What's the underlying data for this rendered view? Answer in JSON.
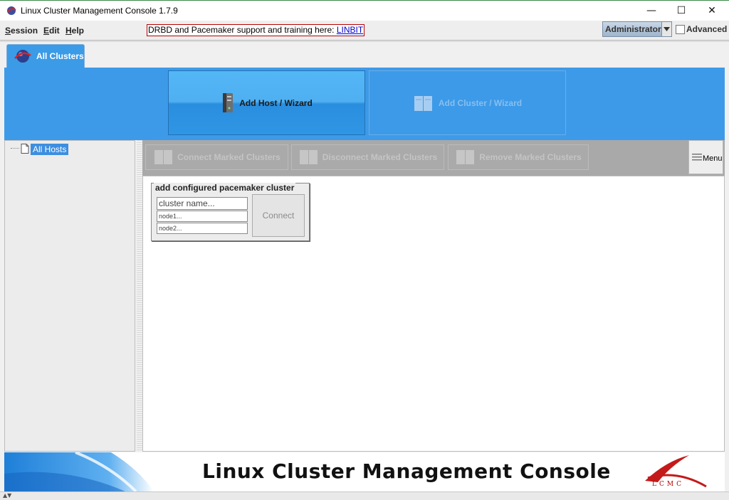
{
  "window": {
    "title": "Linux Cluster Management Console 1.7.9",
    "minimize_glyph": "—",
    "maximize_glyph": "☐",
    "close_glyph": "✕"
  },
  "menubar": {
    "items": [
      {
        "label": "Session"
      },
      {
        "label": "Edit"
      },
      {
        "label": "Help"
      }
    ],
    "promo_text": "DRBD and Pacemaker support and training here: ",
    "promo_link": "LINBIT",
    "user_mode": "Administrator",
    "advanced_label": "Advanced",
    "advanced_checked": false
  },
  "tabs": [
    {
      "label": "All Clusters",
      "icon": "all-clusters-icon",
      "selected": true
    }
  ],
  "wizards": {
    "add_host": {
      "label": "Add Host / Wizard",
      "enabled": true,
      "icon": "server-icon"
    },
    "add_cluster": {
      "label": "Add Cluster / Wizard",
      "enabled": false,
      "icon": "servers-icon"
    }
  },
  "tree": {
    "root_label": "All Hosts"
  },
  "cluster_toolbar": {
    "buttons": [
      {
        "label": "Connect Marked Clusters",
        "enabled": false
      },
      {
        "label": "Disconnect Marked Clusters",
        "enabled": false
      },
      {
        "label": "Remove Marked Clusters",
        "enabled": false
      }
    ],
    "menu_label": "Menu"
  },
  "configured_cluster": {
    "title": "add configured pacemaker cluster",
    "cluster_name_value": "cluster name...",
    "node1_value": "node1...",
    "node2_value": "node2...",
    "connect_label": "Connect"
  },
  "footer": {
    "title": "Linux Cluster Management Console",
    "logo_text": "LCMC"
  },
  "colors": {
    "accent_blue": "#3d9ae8",
    "tab_blue": "#3b9be6",
    "promo_border": "#b80000",
    "link": "#0000cc"
  }
}
